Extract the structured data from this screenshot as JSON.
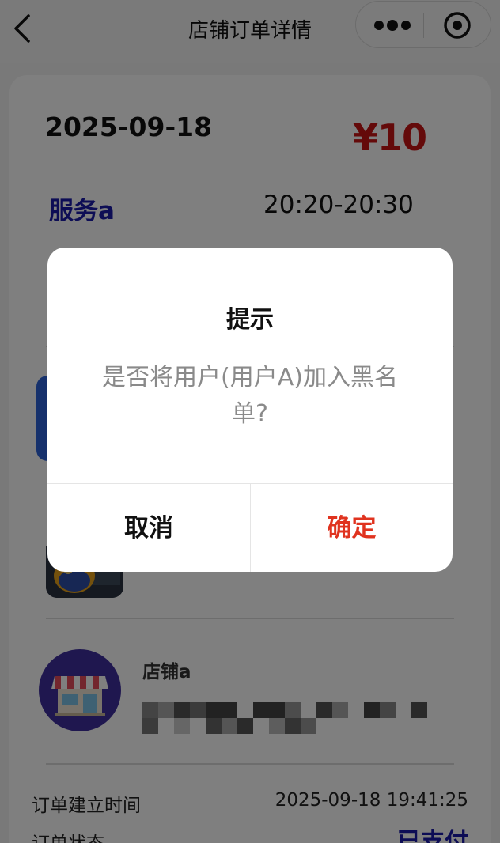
{
  "nav": {
    "title": "店铺订单详情"
  },
  "order": {
    "date": "2025-09-18",
    "price": "¥10",
    "service_name": "服务a",
    "time_range": "20:20-20:30"
  },
  "shop": {
    "name": "店铺a"
  },
  "details": {
    "created_label": "订单建立时间",
    "created_value": "2025-09-18 19:41:25",
    "status_label": "订单状态",
    "status_value": "已支付"
  },
  "dialog": {
    "title": "提示",
    "content": "是否将用户(用户A)加入黑名单?",
    "cancel_label": "取消",
    "confirm_label": "确定"
  },
  "colors": {
    "price": "#c81414",
    "service": "#1a1aaa",
    "confirm": "#e0331f",
    "accent_blue": "#2c63d9"
  },
  "icons": [
    "back-arrow-icon",
    "more-dots-icon",
    "close-target-icon",
    "shop-storefront-icon"
  ]
}
